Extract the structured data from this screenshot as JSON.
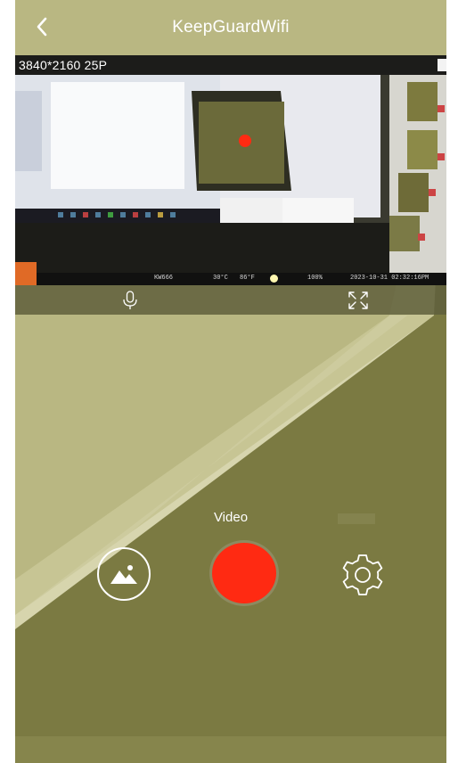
{
  "header": {
    "title": "KeepGuardWifi",
    "back_icon": "chevron-left-icon"
  },
  "preview": {
    "resolution_label": "3840*2160 25P",
    "osd": {
      "device": "KW666",
      "temp_c": "30°C",
      "temp_f": "86°F",
      "battery": "100%",
      "datetime": "2023-10-31 02:32:16PM"
    }
  },
  "controls": {
    "mic_icon": "microphone-icon",
    "fullscreen_icon": "fullscreen-icon"
  },
  "capture": {
    "mode_label": "Video",
    "gallery_icon": "gallery-icon",
    "record_icon": "record-button",
    "settings_icon": "gear-icon"
  },
  "colors": {
    "background": "#7b7a42",
    "background_light": "#c7c594",
    "record": "#ff2a12",
    "osd_logo": "#e06a26"
  }
}
